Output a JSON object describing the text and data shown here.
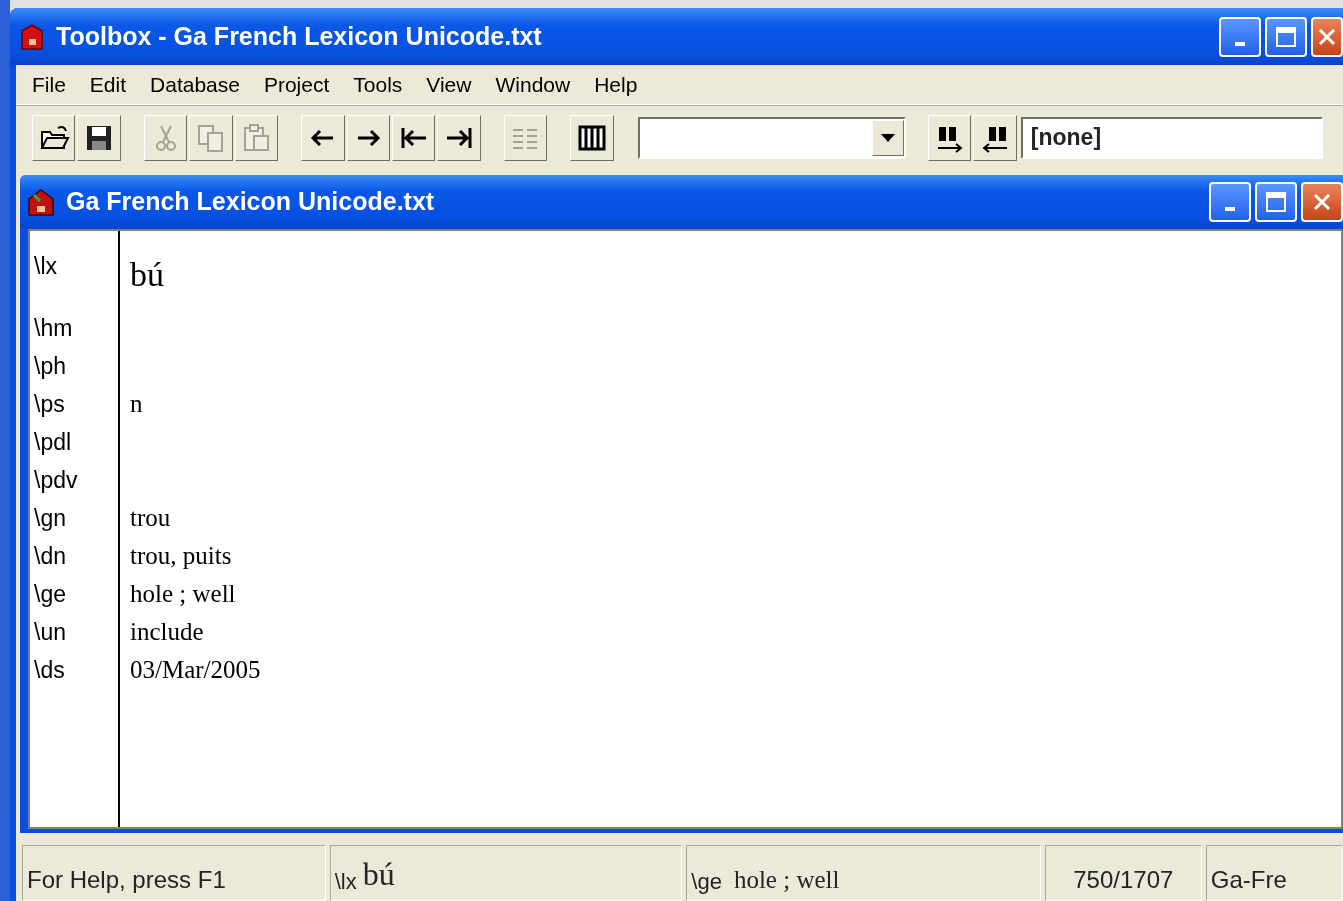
{
  "window": {
    "title": "Toolbox - Ga French Lexicon Unicode.txt"
  },
  "menu": [
    "File",
    "Edit",
    "Database",
    "Project",
    "Tools",
    "View",
    "Window",
    "Help"
  ],
  "toolbar": [
    {
      "kind": "open",
      "disabled": false
    },
    {
      "kind": "save",
      "disabled": false
    },
    {
      "kind": "separator"
    },
    {
      "kind": "cut",
      "disabled": true
    },
    {
      "kind": "copy",
      "disabled": true
    },
    {
      "kind": "paste",
      "disabled": true
    },
    {
      "kind": "separator"
    },
    {
      "kind": "back",
      "disabled": false
    },
    {
      "kind": "forward",
      "disabled": false
    },
    {
      "kind": "first",
      "disabled": false
    },
    {
      "kind": "last",
      "disabled": false
    },
    {
      "kind": "separator"
    },
    {
      "kind": "format",
      "disabled": true
    },
    {
      "kind": "separator"
    },
    {
      "kind": "columns",
      "disabled": false
    },
    {
      "kind": "combo"
    },
    {
      "kind": "find-next",
      "disabled": false
    },
    {
      "kind": "find-previous",
      "disabled": false
    },
    {
      "kind": "combo",
      "value": "[none]"
    }
  ],
  "document": {
    "title": "Ga French Lexicon Unicode.txt",
    "fields": [
      {
        "marker": "\\lx",
        "value": "bú",
        "kind": "headword"
      },
      {
        "marker": "\\hm"
      },
      {
        "marker": "\\ph"
      },
      {
        "marker": "\\ps",
        "value": "n"
      },
      {
        "marker": "\\pdl"
      },
      {
        "marker": "\\pdv"
      },
      {
        "marker": "\\gn",
        "value": "trou"
      },
      {
        "marker": "\\dn",
        "value": "trou, puits"
      },
      {
        "marker": "\\ge",
        "value": "hole ; well"
      },
      {
        "marker": "\\un",
        "value": "include"
      },
      {
        "marker": "\\ds",
        "value": "03/Mar/2005"
      }
    ]
  },
  "status_bar": [
    {
      "kind": "text",
      "text": "For Help, press F1"
    },
    {
      "kind": "field",
      "marker": "\\lx",
      "value": "bú",
      "headword": true
    },
    {
      "kind": "field",
      "marker": "\\ge",
      "value": "hole ; well",
      "headword": false
    },
    {
      "kind": "count",
      "text": "750/1707"
    },
    {
      "kind": "text",
      "text": "Ga-Fre"
    }
  ]
}
